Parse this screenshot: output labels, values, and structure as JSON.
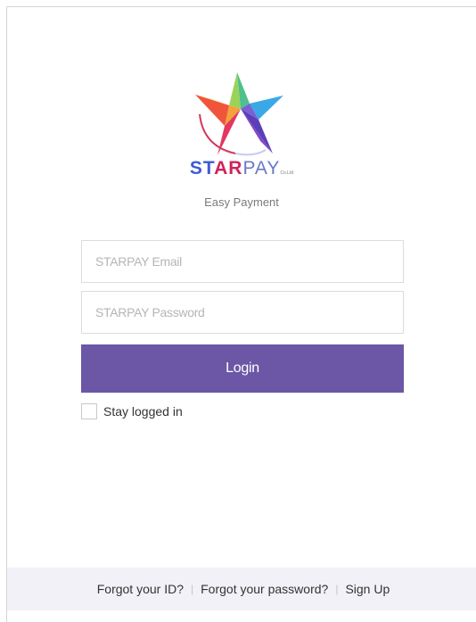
{
  "brand": {
    "name_part1": "ST",
    "name_part2": "AR",
    "name_part3": "PAY",
    "name_suffix": "Co.Ltd",
    "tagline": "Easy Payment"
  },
  "login_form": {
    "email_placeholder": "STARPAY Email",
    "password_placeholder": "STARPAY Password",
    "login_label": "Login",
    "stay_logged_in_label": "Stay logged in",
    "stay_logged_in_checked": false
  },
  "footer": {
    "links": [
      "Forgot your ID?",
      "Forgot your password?",
      "Sign Up"
    ],
    "separator": "|"
  },
  "colors": {
    "login_button": "#6b57a6",
    "footer_bg": "#f2f1f7",
    "brand_blue": "#3f5bd2",
    "brand_red": "#d0235a"
  },
  "icons": {
    "logo": "multicolor-star-logo"
  }
}
